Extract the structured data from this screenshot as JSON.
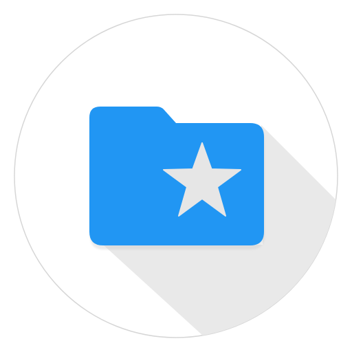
{
  "icon": {
    "name": "starred-folder-icon",
    "glyph": "folder-with-star",
    "colors": {
      "background": "#ffffff",
      "circle": "#ffffff",
      "circle_border": "#d6d6d6",
      "long_shadow": "#e9e9e9",
      "folder": "#2196f3",
      "folder_shadow": "#1e88e5",
      "star": "#e6e6e6"
    }
  }
}
